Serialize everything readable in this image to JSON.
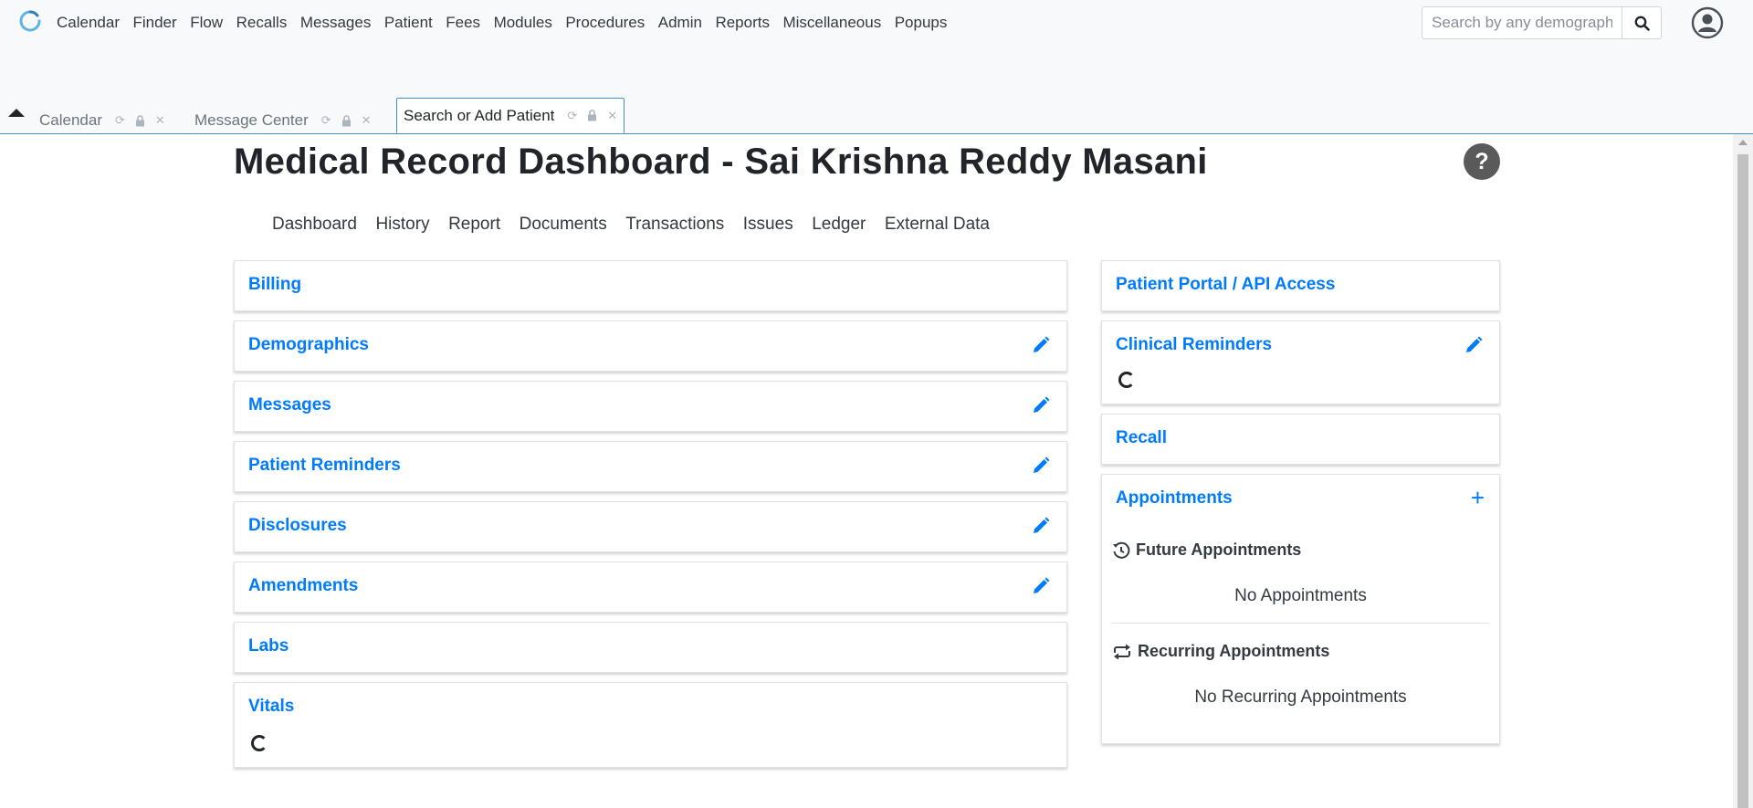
{
  "nav": {
    "menu": [
      "Calendar",
      "Finder",
      "Flow",
      "Recalls",
      "Messages",
      "Patient",
      "Fees",
      "Modules",
      "Procedures",
      "Admin",
      "Reports",
      "Miscellaneous",
      "Popups"
    ],
    "search_placeholder": "Search by any demographics"
  },
  "tabs": [
    {
      "label": "Calendar",
      "active": false
    },
    {
      "label": "Message Center",
      "active": false
    },
    {
      "label": "Search or Add Patient",
      "active": true
    }
  ],
  "page": {
    "title": "Medical Record Dashboard - Sai Krishna Reddy Masani",
    "help": "?",
    "subnav": [
      "Dashboard",
      "History",
      "Report",
      "Documents",
      "Transactions",
      "Issues",
      "Ledger",
      "External Data"
    ]
  },
  "left_cards": [
    {
      "title": "Billing",
      "editable": false
    },
    {
      "title": "Demographics",
      "editable": true
    },
    {
      "title": "Messages",
      "editable": true
    },
    {
      "title": "Patient Reminders",
      "editable": true
    },
    {
      "title": "Disclosures",
      "editable": true
    },
    {
      "title": "Amendments",
      "editable": true
    },
    {
      "title": "Labs",
      "editable": false
    },
    {
      "title": "Vitals",
      "editable": false,
      "loading": true
    }
  ],
  "right_cards": {
    "portal": "Patient Portal / API Access",
    "clinical_reminders": "Clinical Reminders",
    "recall": "Recall",
    "appointments": {
      "title": "Appointments",
      "add": "+",
      "future_label": "Future Appointments",
      "future_empty": "No Appointments",
      "recurring_label": "Recurring Appointments",
      "recurring_empty": "No Recurring Appointments"
    }
  },
  "colors": {
    "accent": "#007bff",
    "tab_border": "#3f8fd3"
  }
}
